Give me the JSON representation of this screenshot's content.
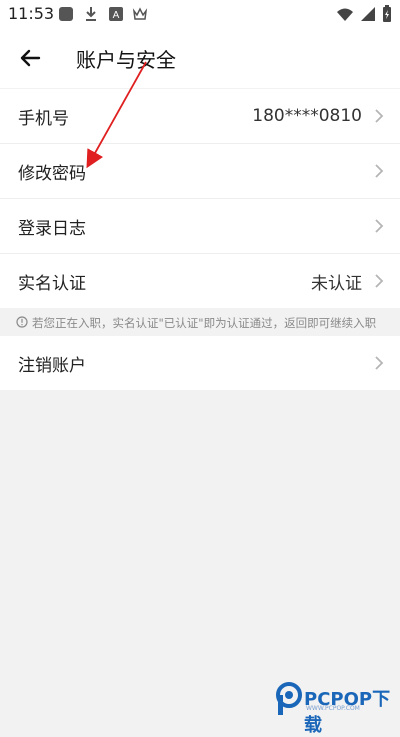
{
  "status_bar": {
    "time": "11:53",
    "icons": [
      "app-icon",
      "download-icon",
      "a-icon",
      "crown-icon",
      "wifi-icon",
      "signal-icon",
      "battery-icon"
    ]
  },
  "app_bar": {
    "title": "账户与安全",
    "back_icon": "arrow-left-icon"
  },
  "settings": {
    "phone": {
      "label": "手机号",
      "value": "180****0810"
    },
    "password": {
      "label": "修改密码"
    },
    "login_log": {
      "label": "登录日志"
    },
    "real_name": {
      "label": "实名认证",
      "value": "未认证"
    },
    "notice": "若您正在入职，实名认证\"已认证\"即为认证通过，返回即可继续入职",
    "delete_account": {
      "label": "注销账户"
    }
  },
  "watermark": {
    "text": "PCPOP下载",
    "sub": "WWW.PCPOP.COM"
  },
  "colors": {
    "annotation_arrow": "#e02020",
    "watermark_blue": "#1a66b8",
    "background": "#f2f2f2"
  }
}
